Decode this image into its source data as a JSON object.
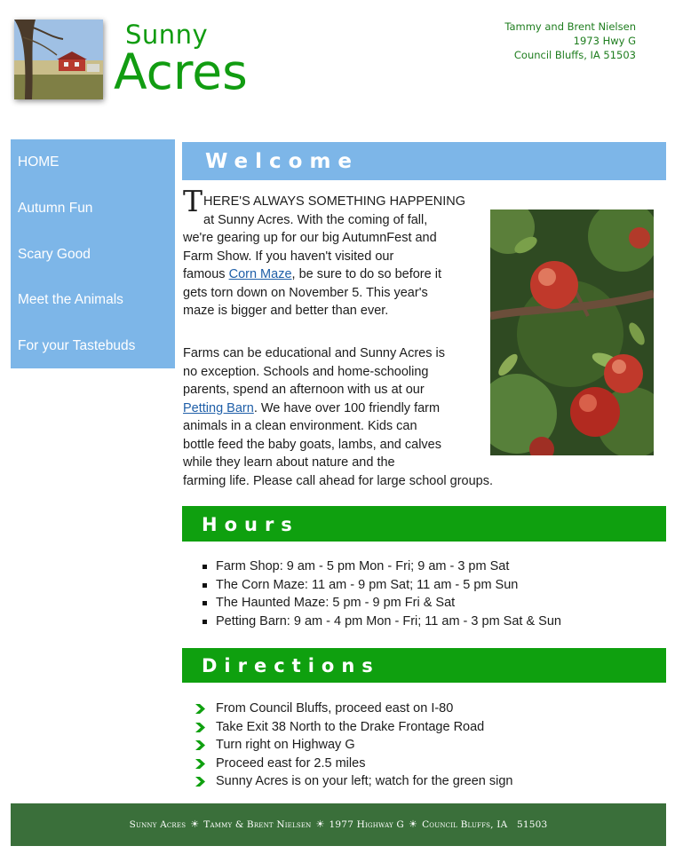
{
  "header": {
    "logo_word1": "Sunny",
    "logo_word2": "Acres",
    "address_lines": [
      "Tammy and Brent Nielsen",
      "1973 Hwy G",
      "Council Bluffs, IA  51503"
    ]
  },
  "nav": {
    "items": [
      {
        "label": "HOME"
      },
      {
        "label": "Autumn Fun"
      },
      {
        "label": "Scary Good"
      },
      {
        "label": "Meet the Animals"
      },
      {
        "label": "For your Tastebuds"
      }
    ]
  },
  "welcome": {
    "heading": "Welcome",
    "dropcap": "T",
    "p1_line1": "HERE'S ALWAYS SOMETHING HAPPENING",
    "p1_line2": "at Sunny Acres. With the coming of fall,",
    "p1_line3": "we're gearing up for our big AutumnFest and",
    "p1_line4": "Farm Show. If you haven't visited our",
    "p1_line5_pre": "famous ",
    "p1_link": "Corn Maze",
    "p1_line5_post": ", be sure to do so before it",
    "p1_line6": "gets torn down on November 5. This year's",
    "p1_line7": "maze is bigger and better than ever.",
    "p2_line1": "Farms can be educational and Sunny Acres is",
    "p2_line2": "no exception. Schools and home-schooling",
    "p2_line3": "parents, spend an afternoon with us at our",
    "p2_link": "Petting Barn",
    "p2_line4_post": ". We have over 100 friendly farm",
    "p2_line5": "animals in a clean environment. Kids can",
    "p2_line6": "bottle feed the baby goats, lambs, and calves",
    "p2_line7": "while they learn about nature and the",
    "p2_line8": "farming life. Please call ahead for large school groups."
  },
  "hours": {
    "heading": "Hours",
    "items": [
      "Farm Shop: 9 am - 5 pm Mon - Fri; 9 am - 3 pm Sat",
      "The Corn Maze: 11 am - 9 pm Sat; 11 am - 5 pm Sun",
      "The Haunted Maze: 5 pm - 9 pm Fri & Sat",
      "Petting Barn: 9 am - 4 pm Mon - Fri; 11 am - 3 pm Sat & Sun"
    ]
  },
  "directions": {
    "heading": "Directions",
    "items": [
      "From Council Bluffs, proceed east on I-80",
      "Take Exit 38 North to the Drake Frontage Road",
      "Turn right on Highway G",
      "Proceed east for 2.5 miles",
      "Sunny Acres is on your left; watch for the green sign"
    ]
  },
  "footer": {
    "part1": "Sunny Acres",
    "part2": "Tammy & Brent Nielsen",
    "part3": "1977 Highway G",
    "part4": "Council Bluffs, IA",
    "zip": "51503",
    "separator": "☀"
  },
  "colors": {
    "brand_green": "#119c11",
    "nav_blue": "#7db6e8",
    "section_green": "#0fa00f",
    "footer_green": "#3a6f3a",
    "link_blue": "#1f5fa8"
  },
  "icons": {
    "nav_bullet": "none",
    "hours_bullet": "square-bullet-icon",
    "directions_bullet": "green-arrow-icon",
    "footer_separator": "sun-icon"
  }
}
